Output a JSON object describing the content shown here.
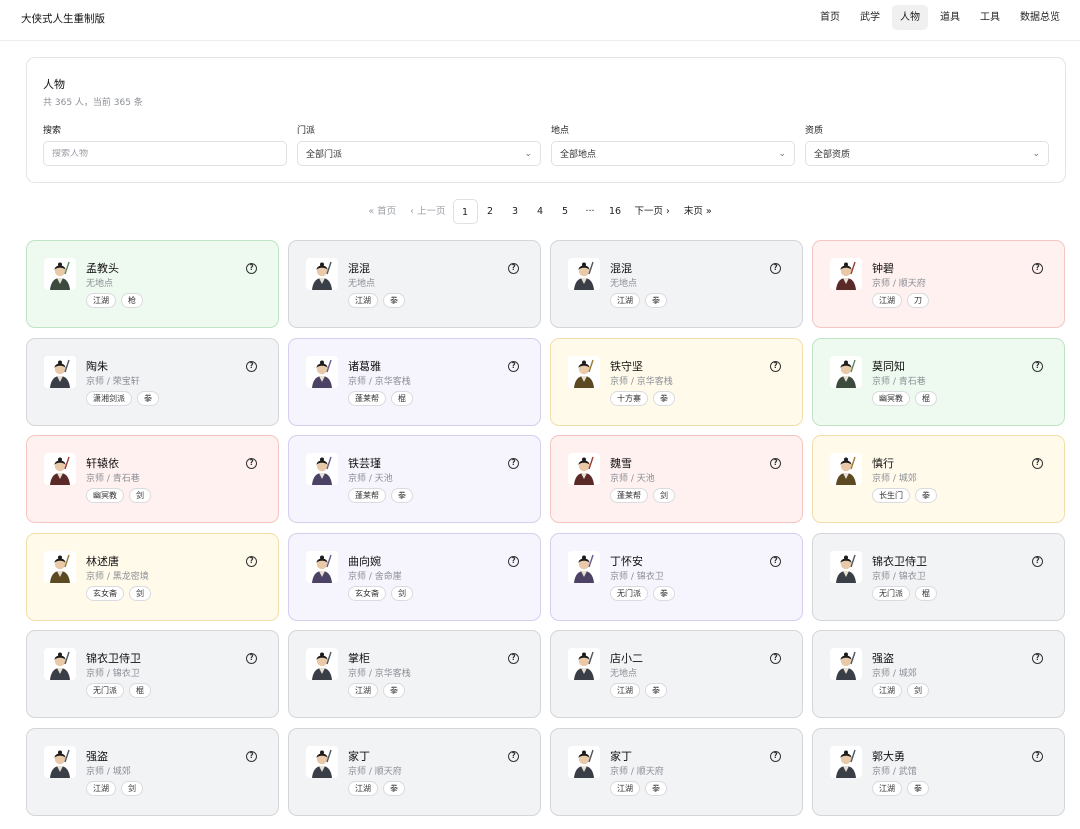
{
  "app": {
    "title": "大侠式人生重制版"
  },
  "nav": [
    {
      "label": "首页",
      "active": false
    },
    {
      "label": "武学",
      "active": false
    },
    {
      "label": "人物",
      "active": true
    },
    {
      "label": "道具",
      "active": false
    },
    {
      "label": "工具",
      "active": false
    },
    {
      "label": "数据总览",
      "active": false
    }
  ],
  "panel": {
    "title": "人物",
    "subtitle": "共 365 人，当前 365 条",
    "search": {
      "label": "搜索",
      "placeholder": "搜索人物",
      "value": ""
    },
    "sect": {
      "label": "门派",
      "value": "全部门派"
    },
    "location": {
      "label": "地点",
      "value": "全部地点"
    },
    "aptitude": {
      "label": "资质",
      "value": "全部资质"
    }
  },
  "pagination": {
    "first": "« 首页",
    "prev": "‹ 上一页",
    "pages": [
      "1",
      "2",
      "3",
      "4",
      "5",
      "···",
      "16"
    ],
    "current": "1",
    "next": "下一页 ›",
    "last": "末页 »"
  },
  "characters": [
    {
      "name": "孟教头",
      "location": "无地点",
      "tags": [
        "江湖",
        "枪"
      ],
      "color": "green",
      "icon": "spear-warrior-avatar"
    },
    {
      "name": "混混",
      "location": "无地点",
      "tags": [
        "江湖",
        "拳"
      ],
      "color": "gray",
      "icon": "thug-avatar"
    },
    {
      "name": "混混",
      "location": "无地点",
      "tags": [
        "江湖",
        "拳"
      ],
      "color": "gray",
      "icon": "thug-avatar"
    },
    {
      "name": "钟碧",
      "location": "京师 / 顺天府",
      "tags": [
        "江湖",
        "刀"
      ],
      "color": "red",
      "icon": "female-swordswoman-avatar"
    },
    {
      "name": "陶朱",
      "location": "京师 / 荣宝轩",
      "tags": [
        "潇湘剑派",
        "拳"
      ],
      "color": "gray",
      "icon": "male-robed-avatar"
    },
    {
      "name": "诸葛雅",
      "location": "京师 / 京华客栈",
      "tags": [
        "蓬莱帮",
        "棍"
      ],
      "color": "purple",
      "icon": "female-scholar-avatar"
    },
    {
      "name": "铁守坚",
      "location": "京师 / 京华客栈",
      "tags": [
        "十方寨",
        "拳"
      ],
      "color": "yellow",
      "icon": "red-armored-warrior-avatar"
    },
    {
      "name": "莫同知",
      "location": "京师 / 青石巷",
      "tags": [
        "幽冥教",
        "棍"
      ],
      "color": "green",
      "icon": "elder-avatar"
    },
    {
      "name": "轩辕依",
      "location": "京师 / 青石巷",
      "tags": [
        "幽冥教",
        "剑"
      ],
      "color": "red",
      "icon": "straw-hat-avatar"
    },
    {
      "name": "铁芸瑾",
      "location": "京师 / 天池",
      "tags": [
        "蓬莱帮",
        "拳"
      ],
      "color": "purple",
      "icon": "female-warrior-avatar"
    },
    {
      "name": "魏雪",
      "location": "京师 / 天池",
      "tags": [
        "蓬莱帮",
        "剑"
      ],
      "color": "red",
      "icon": "female-blue-robe-avatar"
    },
    {
      "name": "慎行",
      "location": "京师 / 城郊",
      "tags": [
        "长生门",
        "拳"
      ],
      "color": "yellow",
      "icon": "monk-avatar"
    },
    {
      "name": "林述唐",
      "location": "京师 / 黑龙密境",
      "tags": [
        "玄女斋",
        "剑"
      ],
      "color": "yellow",
      "icon": "swordsman-avatar"
    },
    {
      "name": "曲向婉",
      "location": "京师 / 舍命崖",
      "tags": [
        "玄女斋",
        "剑"
      ],
      "color": "purple",
      "icon": "female-white-robe-avatar"
    },
    {
      "name": "丁怀安",
      "location": "京师 / 锦衣卫",
      "tags": [
        "无门派",
        "拳"
      ],
      "color": "purple",
      "icon": "elder-avatar"
    },
    {
      "name": "锦衣卫侍卫",
      "location": "京师 / 锦衣卫",
      "tags": [
        "无门派",
        "棍"
      ],
      "color": "gray",
      "icon": "guard-avatar"
    },
    {
      "name": "锦衣卫侍卫",
      "location": "京师 / 锦衣卫",
      "tags": [
        "无门派",
        "棍"
      ],
      "color": "gray",
      "icon": "guard-avatar"
    },
    {
      "name": "掌柜",
      "location": "京师 / 京华客栈",
      "tags": [
        "江湖",
        "拳"
      ],
      "color": "gray",
      "icon": "merchant-avatar"
    },
    {
      "name": "店小二",
      "location": "无地点",
      "tags": [
        "江湖",
        "拳"
      ],
      "color": "gray",
      "icon": "waiter-avatar"
    },
    {
      "name": "强盗",
      "location": "京师 / 城郊",
      "tags": [
        "江湖",
        "剑"
      ],
      "color": "gray",
      "icon": "bandit-avatar"
    },
    {
      "name": "强盗",
      "location": "京师 / 城郊",
      "tags": [
        "江湖",
        "剑"
      ],
      "color": "gray",
      "icon": "bandit-avatar"
    },
    {
      "name": "家丁",
      "location": "京师 / 顺天府",
      "tags": [
        "江湖",
        "拳"
      ],
      "color": "gray",
      "icon": "servant-avatar"
    },
    {
      "name": "家丁",
      "location": "京师 / 顺天府",
      "tags": [
        "江湖",
        "拳"
      ],
      "color": "gray",
      "icon": "servant-avatar"
    },
    {
      "name": "郭大勇",
      "location": "京师 / 武馆",
      "tags": [
        "江湖",
        "拳"
      ],
      "color": "gray",
      "icon": "martial-artist-avatar"
    }
  ]
}
